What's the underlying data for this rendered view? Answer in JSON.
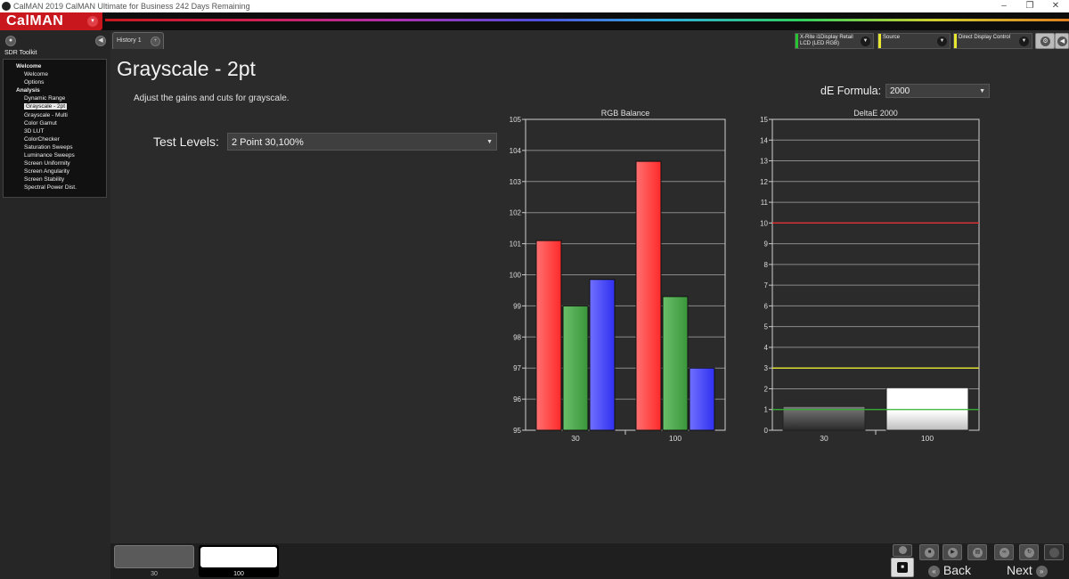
{
  "window": {
    "title": "CalMAN 2019 CalMAN Ultimate for Business 242 Days Remaining",
    "min": "–",
    "max": "❐",
    "close": "✕"
  },
  "brand": {
    "name": "CalMAN",
    "menu_icon": "▾"
  },
  "sidebar": {
    "title": "SDR Toolkit",
    "tree": [
      {
        "type": "group",
        "label": "Welcome"
      },
      {
        "type": "leaf",
        "label": "Welcome"
      },
      {
        "type": "leaf",
        "label": "Options"
      },
      {
        "type": "group",
        "label": "Analysis"
      },
      {
        "type": "leaf",
        "label": "Dynamic Range"
      },
      {
        "type": "leaf",
        "label": "Grayscale - 2pt",
        "selected": true
      },
      {
        "type": "leaf",
        "label": "Grayscale - Multi"
      },
      {
        "type": "leaf",
        "label": "Color Gamut"
      },
      {
        "type": "leaf",
        "label": "3D LUT"
      },
      {
        "type": "leaf",
        "label": "ColorChecker"
      },
      {
        "type": "leaf",
        "label": "Saturation Sweeps"
      },
      {
        "type": "leaf",
        "label": "Luminance Sweeps"
      },
      {
        "type": "leaf",
        "label": "Screen Uniformity"
      },
      {
        "type": "leaf",
        "label": "Screen Angularity"
      },
      {
        "type": "leaf",
        "label": "Screen Stability"
      },
      {
        "type": "leaf",
        "label": "Spectral Power Dist."
      }
    ]
  },
  "tabs": [
    {
      "label": "History 1"
    }
  ],
  "devices": {
    "meter": {
      "line1": "X-Rite i1Display Retail",
      "line2": "LCD (LED RGB)",
      "color": "#29c232"
    },
    "source": {
      "line1": "Source",
      "color": "#e8e830"
    },
    "display": {
      "line1": "Direct Display Control",
      "color": "#e8e830"
    }
  },
  "main": {
    "title": "Grayscale - 2pt",
    "description": "Adjust the gains and cuts for grayscale.",
    "test_levels_label": "Test Levels:",
    "test_levels_value": "2 Point 30,100%",
    "de_formula_label": "dE Formula:",
    "de_formula_value": "2000"
  },
  "chart_data": [
    {
      "type": "bar",
      "title": "RGB Balance",
      "categories": [
        "30",
        "100"
      ],
      "series": [
        {
          "values": [
            101.1,
            103.65
          ],
          "color": "#ff3030"
        },
        {
          "values": [
            99.0,
            99.3
          ],
          "color": "#3a9a3a"
        },
        {
          "values": [
            99.85,
            97.0
          ],
          "color": "#3a3aff"
        }
      ],
      "ylim": [
        95,
        105
      ],
      "yticks": [
        95,
        96,
        97,
        98,
        99,
        100,
        101,
        102,
        103,
        104,
        105
      ],
      "grid": true
    },
    {
      "type": "bar",
      "title": "DeltaE 2000",
      "categories": [
        "30",
        "100"
      ],
      "values": [
        1.15,
        2.05
      ],
      "bar_colors": [
        "#6a6a6a",
        "#ffffff"
      ],
      "ylim": [
        0,
        15
      ],
      "yticks": [
        0,
        1,
        2,
        3,
        4,
        5,
        6,
        7,
        8,
        9,
        10,
        11,
        12,
        13,
        14,
        15
      ],
      "reference_lines": [
        {
          "y": 10,
          "color": "#e03030"
        },
        {
          "y": 3,
          "color": "#e8e830"
        },
        {
          "y": 1,
          "color": "#30b030"
        }
      ],
      "grid": true
    }
  ],
  "bottom": {
    "swatches": [
      {
        "label": "30",
        "color": "#5a5a5a"
      },
      {
        "label": "100",
        "color": "#ffffff"
      }
    ],
    "back_label": "Back",
    "next_label": "Next"
  }
}
